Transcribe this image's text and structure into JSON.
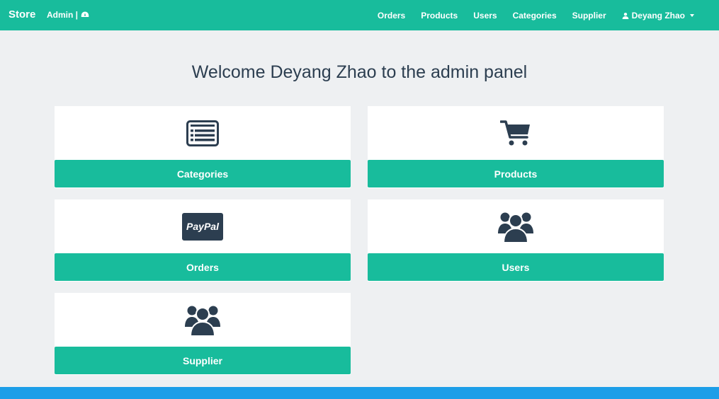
{
  "nav": {
    "brand": "Store",
    "admin_label": "Admin |",
    "links": [
      "Orders",
      "Products",
      "Users",
      "Categories",
      "Supplier"
    ],
    "user": "Deyang Zhao"
  },
  "main": {
    "title": "Welcome Deyang Zhao to the admin panel",
    "cards": [
      {
        "label": "Categories",
        "icon": "list-icon"
      },
      {
        "label": "Products",
        "icon": "cart-icon"
      },
      {
        "label": "Orders",
        "icon": "paypal-icon",
        "icon_text": "PayPal"
      },
      {
        "label": "Users",
        "icon": "users-icon"
      },
      {
        "label": "Supplier",
        "icon": "users-icon"
      }
    ]
  },
  "colors": {
    "accent": "#18bc9c",
    "text_dark": "#2c3e50",
    "background": "#eef0f2",
    "footer_bar": "#1c9ee8"
  }
}
